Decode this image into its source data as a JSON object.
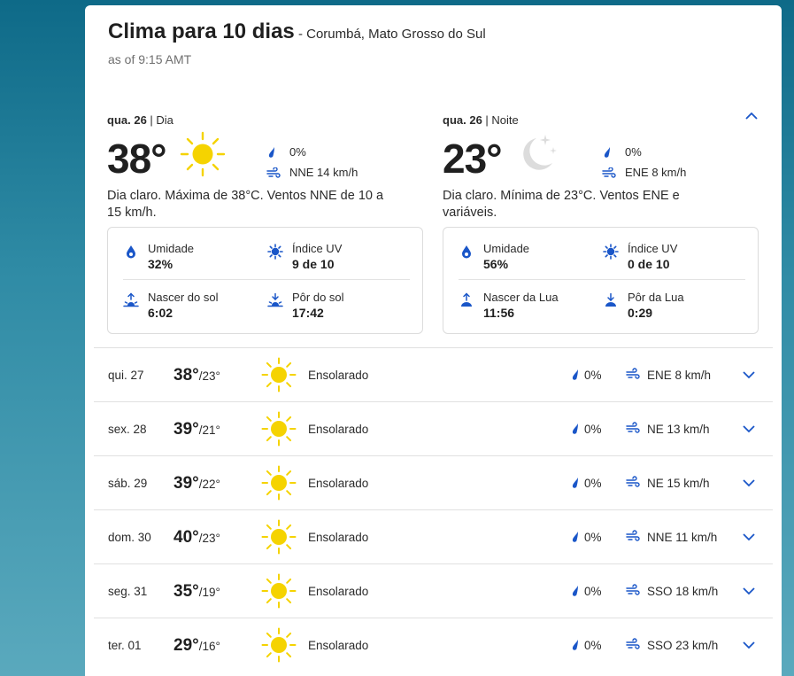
{
  "header": {
    "title": "Clima para 10 dias",
    "location": " - Corumbá, Mato Grosso do Sul",
    "as_of": "as of 9:15 AMT"
  },
  "day": {
    "date": "qua. 26",
    "period": "Dia",
    "temp": "38°",
    "icon": "sun-icon",
    "precip": "0%",
    "wind": "NNE 14 km/h",
    "desc": "Dia claro. Máxima de 38°C. Ventos NNE de 10 a 15 km/h.",
    "details": [
      {
        "icon": "humidity-icon",
        "label": "Umidade",
        "value": "32%"
      },
      {
        "icon": "uv-icon",
        "label": "Índice UV",
        "value": "9 de 10"
      },
      {
        "icon": "sunrise-icon",
        "label": "Nascer do sol",
        "value": "6:02"
      },
      {
        "icon": "sunset-icon",
        "label": "Pôr do sol",
        "value": "17:42"
      }
    ]
  },
  "night": {
    "date": "qua. 26",
    "period": "Noite",
    "temp": "23°",
    "icon": "moon-icon",
    "precip": "0%",
    "wind": "ENE 8 km/h",
    "desc": "Dia claro. Mínima de 23°C. Ventos ENE e variáveis.",
    "details": [
      {
        "icon": "humidity-icon",
        "label": "Umidade",
        "value": "56%"
      },
      {
        "icon": "uv-icon",
        "label": "Índice UV",
        "value": "0 de 10"
      },
      {
        "icon": "moonrise-icon",
        "label": "Nascer da Lua",
        "value": "11:56"
      },
      {
        "icon": "moonset-icon",
        "label": "Pôr da Lua",
        "value": "0:29"
      }
    ]
  },
  "forecast": [
    {
      "date": "qui. 27",
      "high": "38°",
      "low": "/23°",
      "condition": "Ensolarado",
      "precip": "0%",
      "wind": "ENE 8 km/h"
    },
    {
      "date": "sex. 28",
      "high": "39°",
      "low": "/21°",
      "condition": "Ensolarado",
      "precip": "0%",
      "wind": "NE 13 km/h"
    },
    {
      "date": "sáb. 29",
      "high": "39°",
      "low": "/22°",
      "condition": "Ensolarado",
      "precip": "0%",
      "wind": "NE 15 km/h"
    },
    {
      "date": "dom. 30",
      "high": "40°",
      "low": "/23°",
      "condition": "Ensolarado",
      "precip": "0%",
      "wind": "NNE 11 km/h"
    },
    {
      "date": "seg. 31",
      "high": "35°",
      "low": "/19°",
      "condition": "Ensolarado",
      "precip": "0%",
      "wind": "SSO 18 km/h"
    },
    {
      "date": "ter. 01",
      "high": "29°",
      "low": "/16°",
      "condition": "Ensolarado",
      "precip": "0%",
      "wind": "SSO 23 km/h"
    }
  ],
  "colors": {
    "accent": "#1a56c8",
    "sun": "#f5d300",
    "background_top": "#0e6a88"
  }
}
